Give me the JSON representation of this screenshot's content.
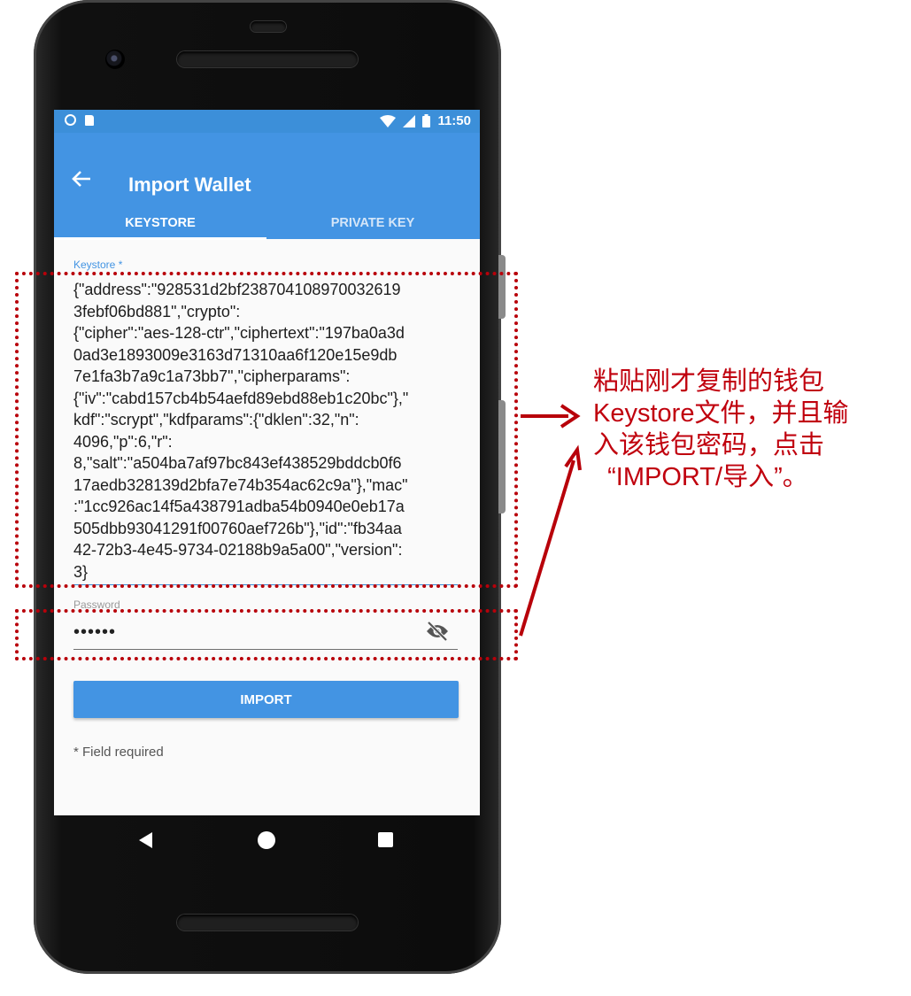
{
  "status_bar": {
    "time": "11:50"
  },
  "app_bar": {
    "title": "Import Wallet",
    "tabs": [
      {
        "label": "KEYSTORE",
        "active": true
      },
      {
        "label": "PRIVATE KEY",
        "active": false
      }
    ]
  },
  "keystore": {
    "label": "Keystore *",
    "lines": [
      "{\"address\":\"928531d2bf238704108970032619",
      "3febf06bd881\",\"crypto\":",
      "{\"cipher\":\"aes-128-ctr\",\"ciphertext\":\"197ba0a3d",
      "0ad3e1893009e3163d71310aa6f120e15e9db",
      "7e1fa3b7a9c1a73bb7\",\"cipherparams\":",
      "{\"iv\":\"cabd157cb4b54aefd89ebd88eb1c20bc\"},\"",
      "kdf\":\"scrypt\",\"kdfparams\":{\"dklen\":32,\"n\":",
      "4096,\"p\":6,\"r\":",
      "8,\"salt\":\"a504ba7af97bc843ef438529bddcb0f6",
      "17aedb328139d2bfa7e74b354ac62c9a\"},\"mac\"",
      ":\"1cc926ac14f5a438791adba54b0940e0eb17a",
      "505dbb93041291f00760aef726b\"},\"id\":\"fb34aa",
      "42-72b3-4e45-9734-02188b9a5a00\",\"version\":",
      "3}"
    ]
  },
  "password": {
    "label": "Password",
    "value": "••••••"
  },
  "import_button": {
    "label": "IMPORT"
  },
  "field_required": "* Field required",
  "annotation": {
    "text": "粘贴刚才复制的钱包\nKeystore文件，并且输\n入该钱包密码，点击\n  “IMPORT/导入”。",
    "color": "#c0000d"
  },
  "colors": {
    "primary": "#4394e3",
    "status_bar": "#3c8fd9",
    "annotation": "#b8000a"
  },
  "icons": [
    "back-arrow-icon",
    "visibility-off-icon",
    "wifi-icon",
    "signal-icon",
    "battery-icon"
  ]
}
